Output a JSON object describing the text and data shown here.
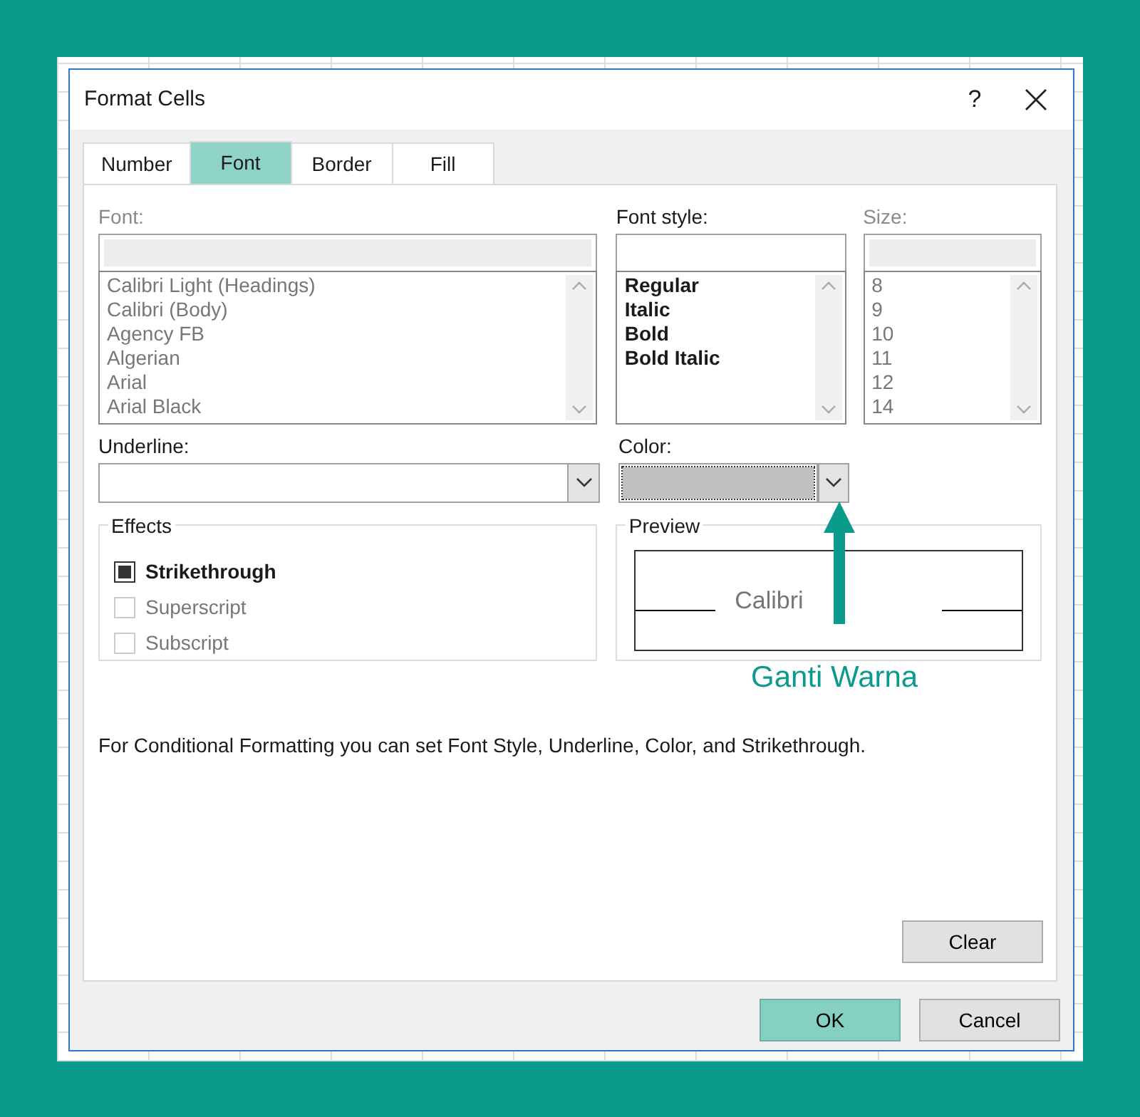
{
  "window": {
    "title": "Format Cells",
    "help": "?"
  },
  "tabs": [
    {
      "label": "Number",
      "selected": false
    },
    {
      "label": "Font",
      "selected": true
    },
    {
      "label": "Border",
      "selected": false
    },
    {
      "label": "Fill",
      "selected": false
    }
  ],
  "font": {
    "label": "Font:",
    "disabled": true,
    "items": [
      "Calibri Light (Headings)",
      "Calibri (Body)",
      "Agency FB",
      "Algerian",
      "Arial",
      "Arial Black"
    ]
  },
  "font_style": {
    "label": "Font style:",
    "disabled": false,
    "items": [
      "Regular",
      "Italic",
      "Bold",
      "Bold Italic"
    ]
  },
  "size": {
    "label": "Size:",
    "disabled": true,
    "items": [
      "8",
      "9",
      "10",
      "11",
      "12",
      "14"
    ]
  },
  "underline": {
    "label": "Underline:"
  },
  "color": {
    "label": "Color:"
  },
  "effects": {
    "title": "Effects",
    "options": [
      {
        "label": "Strikethrough",
        "checked": true,
        "disabled": false
      },
      {
        "label": "Superscript",
        "checked": false,
        "disabled": true
      },
      {
        "label": "Subscript",
        "checked": false,
        "disabled": true
      }
    ]
  },
  "preview": {
    "title": "Preview",
    "sample": "Calibri"
  },
  "annotation": {
    "text": "Ganti Warna"
  },
  "note": "For Conditional Formatting you can set Font Style, Underline, Color, and Strikethrough.",
  "clear_button": "Clear",
  "buttons": [
    {
      "label": "OK",
      "highlighted": true
    },
    {
      "label": "Cancel",
      "highlighted": false
    }
  ]
}
